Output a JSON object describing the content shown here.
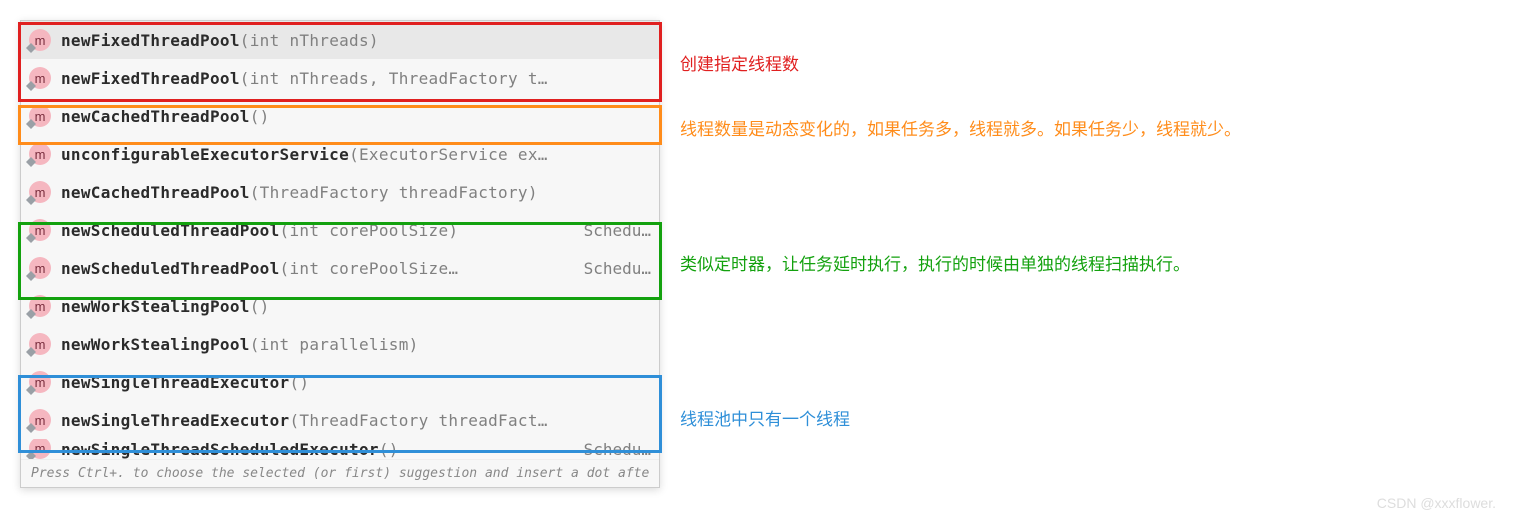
{
  "items": [
    {
      "name": "newFixedThreadPool",
      "params": "(int nThreads)",
      "ret": "",
      "selected": true
    },
    {
      "name": "newFixedThreadPool",
      "params": "(int nThreads, ThreadFactory t…",
      "ret": ""
    },
    {
      "name": "newCachedThreadPool",
      "params": "()",
      "ret": ""
    },
    {
      "name": "unconfigurableExecutorService",
      "params": "(ExecutorService ex…",
      "ret": ""
    },
    {
      "name": "newCachedThreadPool",
      "params": "(ThreadFactory threadFactory)",
      "ret": ""
    },
    {
      "name": "newScheduledThreadPool",
      "params": "(int corePoolSize)",
      "ret": "Schedu…"
    },
    {
      "name": "newScheduledThreadPool",
      "params": "(int corePoolSize…",
      "ret": "Schedu…"
    },
    {
      "name": "newWorkStealingPool",
      "params": "()",
      "ret": ""
    },
    {
      "name": "newWorkStealingPool",
      "params": "(int parallelism)",
      "ret": ""
    },
    {
      "name": "newSingleThreadExecutor",
      "params": "()",
      "ret": ""
    },
    {
      "name": "newSingleThreadExecutor",
      "params": "(ThreadFactory threadFact…",
      "ret": ""
    },
    {
      "name": "newSingleThreadScheduledExecutor",
      "params": "()",
      "ret": "Schedu…",
      "partial": true
    }
  ],
  "hint": "Press Ctrl+. to choose the selected (or first) suggestion and insert a dot afte",
  "annotations": {
    "red": "创建指定线程数",
    "orange": "线程数量是动态变化的，如果任务多，线程就多。如果任务少，线程就少。",
    "green": "类似定时器，让任务延时执行，执行的时候由单独的线程扫描执行。",
    "blue": "线程池中只有一个线程"
  },
  "watermark": "CSDN @xxxflower.",
  "icon_letter": "m"
}
